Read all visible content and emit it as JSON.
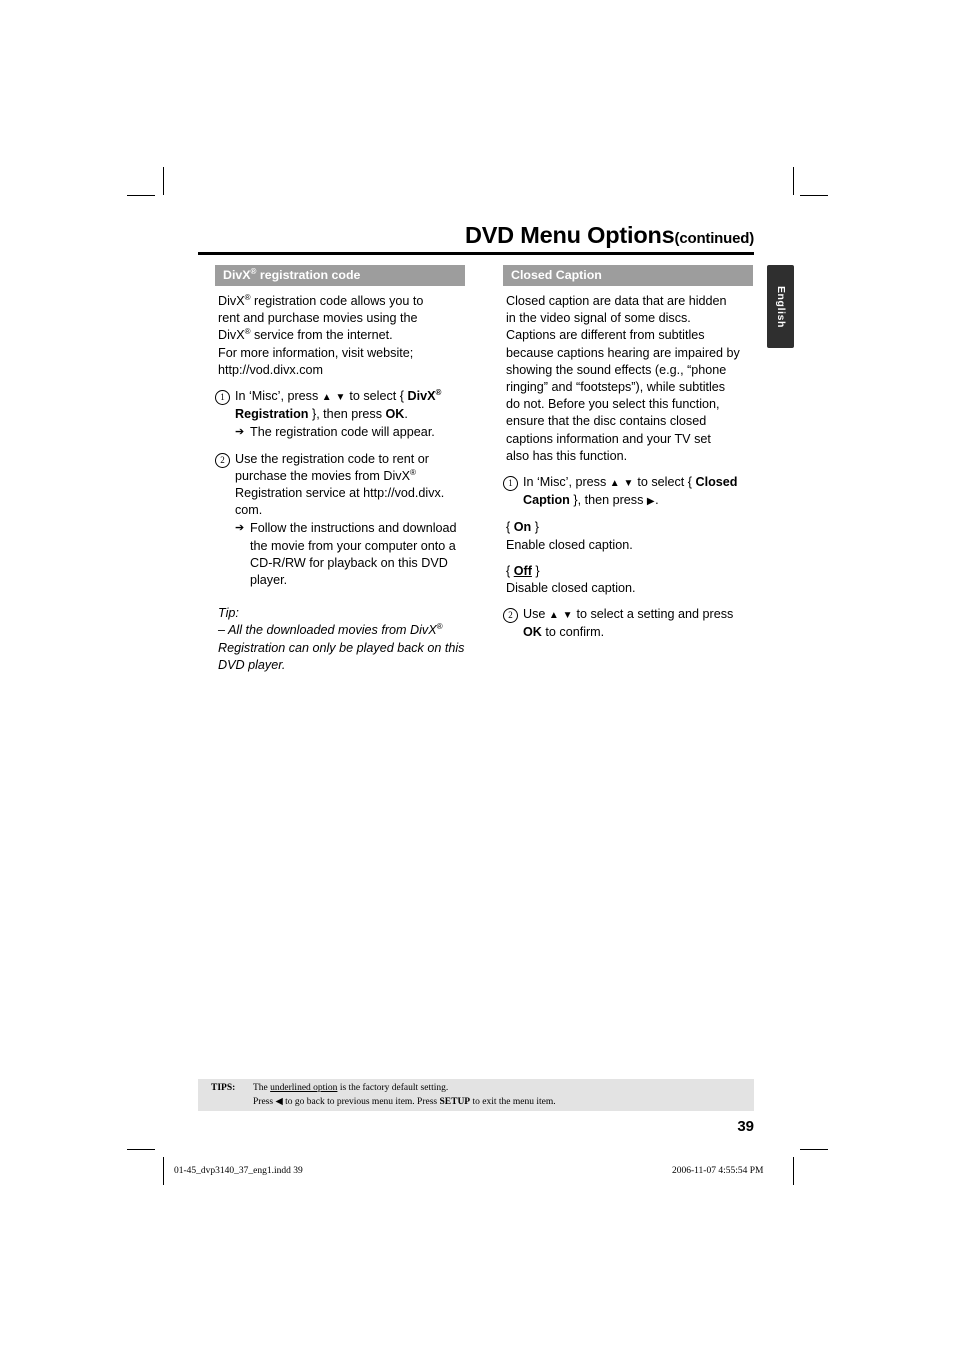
{
  "header": {
    "title": "DVD Menu Options",
    "continued": "(continued)"
  },
  "side_tab": {
    "label": "English"
  },
  "left_column": {
    "section_title_pre": "DivX",
    "section_title_sup": "®",
    "section_title_post": " registration code",
    "intro_line1_pre": "DivX",
    "intro_line1_sup": "®",
    "intro_line1_post": " registration code allows you to",
    "intro_line2": "rent and purchase movies using the",
    "intro_line3_pre": "DivX",
    "intro_line3_sup": "®",
    "intro_line3_post": " service from the internet.",
    "intro_line4": "For more information, visit website;",
    "intro_line5": "http://vod.divx.com",
    "step1": {
      "num": "1",
      "text_a": "In ‘Misc’, press ",
      "arrows": "▲ ▼",
      "text_b": " to select { ",
      "bold_a": "DivX",
      "bold_a_sup": "®",
      "bold_b": "Registration",
      "text_c": " }, then press ",
      "bold_c": "OK",
      "text_d": ".",
      "sub": "The registration code will appear."
    },
    "step2": {
      "num": "2",
      "line1": "Use the registration code to rent or",
      "line2_pre": "purchase the movies from DivX",
      "line2_sup": "®",
      "line3": "Registration service at http://vod.divx.",
      "line4": "com.",
      "sub_line1": "Follow the instructions and download",
      "sub_line2": "the movie from your computer onto a",
      "sub_line3": "CD-R/RW for playback on this DVD",
      "sub_line4": "player."
    },
    "tip": {
      "label": "Tip:",
      "line1_pre": "– All the downloaded movies from DivX",
      "line1_sup": "®",
      "line2": "Registration can only be played back on this",
      "line3": "DVD player."
    }
  },
  "right_column": {
    "section_title": "Closed Caption",
    "intro": [
      "Closed caption are data that are hidden",
      "in the video signal of some discs.",
      "Captions are different from subtitles",
      "because captions hearing are impaired by",
      "showing the sound effects (e.g., “phone",
      "ringing” and “footsteps”), while subtitles",
      "do not. Before you select this function,",
      "ensure that the disc contains closed",
      "captions information and your TV set",
      "also has this function."
    ],
    "step1": {
      "num": "1",
      "text_a": "In ‘Misc’, press ",
      "arrows": "▲ ▼",
      "text_b": " to select { ",
      "bold_a": "Closed",
      "bold_b": "Caption",
      "text_c": " }, then press ",
      "arrow_right": "▶",
      "text_d": "."
    },
    "option_on": {
      "open": "{ ",
      "label": "On",
      "close": " }",
      "desc": "Enable closed caption."
    },
    "option_off": {
      "open": "{ ",
      "label": "Off",
      "close": " }",
      "desc": "Disable closed caption."
    },
    "step2": {
      "num": "2",
      "text_a": "Use ",
      "arrows": "▲ ▼",
      "text_b": " to select a setting and press",
      "bold": "OK",
      "text_c": " to confirm."
    }
  },
  "tips_footer": {
    "label": "TIPS:",
    "line1_pre": "The ",
    "line1_underline": "underlined option",
    "line1_post": " is the factory default setting.",
    "line2_a": "Press ",
    "line2_arrow": "◀",
    "line2_b": " to go back to previous menu item. Press ",
    "line2_bold": "SETUP",
    "line2_c": " to exit the menu item."
  },
  "page_number": "39",
  "print_info": {
    "file": "01-45_dvp3140_37_eng1.indd   39",
    "datetime": "2006-11-07   4:55:54 PM"
  }
}
